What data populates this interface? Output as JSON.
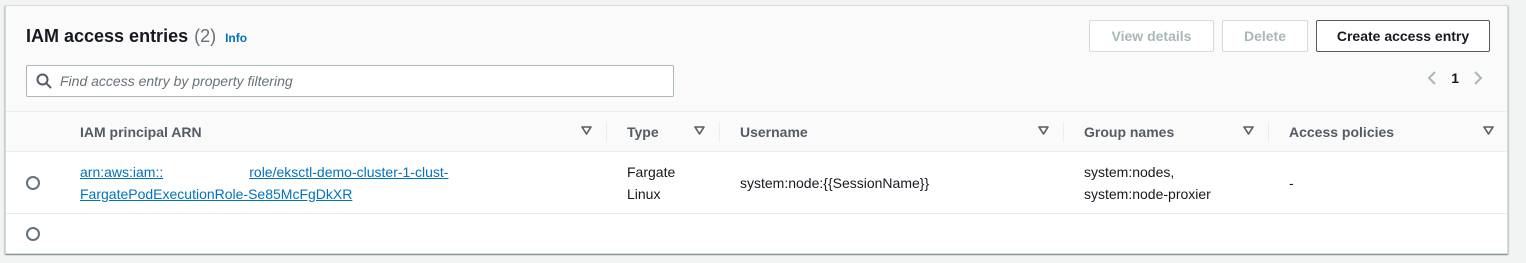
{
  "header": {
    "title": "IAM access entries",
    "count": "(2)",
    "info_label": "Info"
  },
  "buttons": {
    "view_details": "View details",
    "delete": "Delete",
    "create": "Create access entry"
  },
  "search": {
    "placeholder": "Find access entry by property filtering",
    "value": ""
  },
  "pagination": {
    "current_page": "1"
  },
  "columns": {
    "arn": "IAM principal ARN",
    "type": "Type",
    "username": "Username",
    "groups": "Group names",
    "policies": "Access policies"
  },
  "rows": [
    {
      "arn_prefix": "arn:aws:iam::",
      "arn_line1_rest": "role/eksctl-demo-cluster-1-clust-",
      "arn_line2": "FargatePodExecutionRole-Se85McFgDkXR",
      "type_line1": "Fargate",
      "type_line2": "Linux",
      "username": "system:node:{{SessionName}}",
      "groups_line1": "system:nodes,",
      "groups_line2": "system:node-proxier",
      "policies": "-"
    },
    {}
  ],
  "colors": {
    "link": "#0073bb",
    "disabled_text": "#aab7b8",
    "header_bg": "#fafafa"
  }
}
